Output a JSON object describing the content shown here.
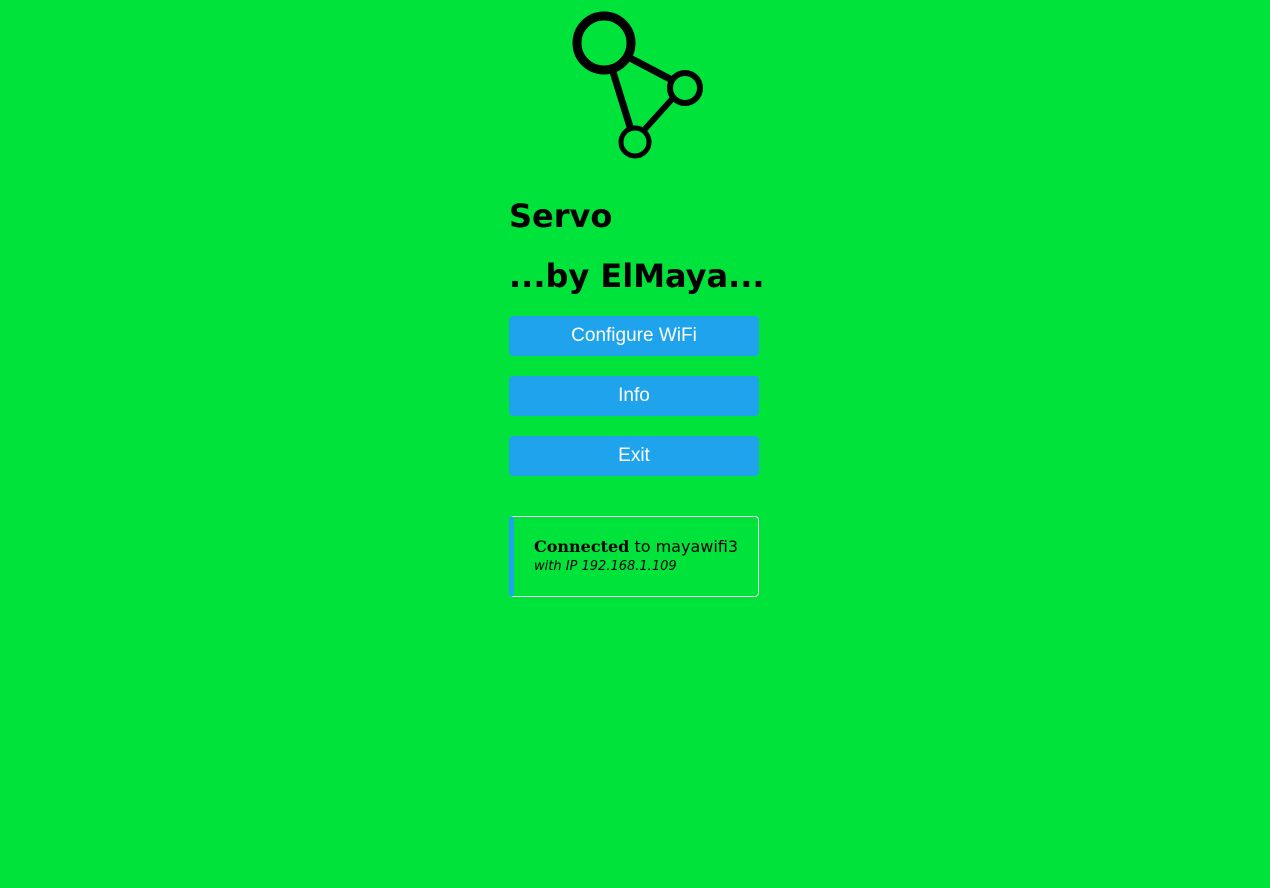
{
  "header": {
    "logo_icon": "network-nodes-icon",
    "title": "Servo",
    "subtitle": "...by ElMaya..."
  },
  "menu": {
    "configure_wifi_label": "Configure WiFi",
    "info_label": "Info",
    "exit_label": "Exit"
  },
  "status": {
    "connected_label": "Connected",
    "to_text": " to mayawifi3",
    "ip_text": "with IP 192.168.1.109"
  },
  "colors": {
    "background": "#00e33a",
    "button": "#1fa3ec",
    "button_text": "#ffffff"
  }
}
